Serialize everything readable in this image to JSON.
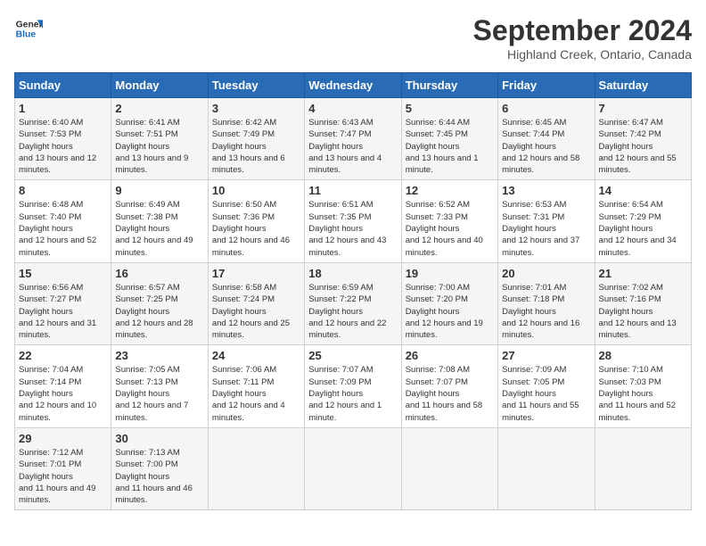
{
  "header": {
    "logo_line1": "General",
    "logo_line2": "Blue",
    "month": "September 2024",
    "location": "Highland Creek, Ontario, Canada"
  },
  "days_of_week": [
    "Sunday",
    "Monday",
    "Tuesday",
    "Wednesday",
    "Thursday",
    "Friday",
    "Saturday"
  ],
  "weeks": [
    [
      {
        "day": "1",
        "sunrise": "6:40 AM",
        "sunset": "7:53 PM",
        "daylight": "13 hours and 12 minutes."
      },
      {
        "day": "2",
        "sunrise": "6:41 AM",
        "sunset": "7:51 PM",
        "daylight": "13 hours and 9 minutes."
      },
      {
        "day": "3",
        "sunrise": "6:42 AM",
        "sunset": "7:49 PM",
        "daylight": "13 hours and 6 minutes."
      },
      {
        "day": "4",
        "sunrise": "6:43 AM",
        "sunset": "7:47 PM",
        "daylight": "13 hours and 4 minutes."
      },
      {
        "day": "5",
        "sunrise": "6:44 AM",
        "sunset": "7:45 PM",
        "daylight": "13 hours and 1 minute."
      },
      {
        "day": "6",
        "sunrise": "6:45 AM",
        "sunset": "7:44 PM",
        "daylight": "12 hours and 58 minutes."
      },
      {
        "day": "7",
        "sunrise": "6:47 AM",
        "sunset": "7:42 PM",
        "daylight": "12 hours and 55 minutes."
      }
    ],
    [
      {
        "day": "8",
        "sunrise": "6:48 AM",
        "sunset": "7:40 PM",
        "daylight": "12 hours and 52 minutes."
      },
      {
        "day": "9",
        "sunrise": "6:49 AM",
        "sunset": "7:38 PM",
        "daylight": "12 hours and 49 minutes."
      },
      {
        "day": "10",
        "sunrise": "6:50 AM",
        "sunset": "7:36 PM",
        "daylight": "12 hours and 46 minutes."
      },
      {
        "day": "11",
        "sunrise": "6:51 AM",
        "sunset": "7:35 PM",
        "daylight": "12 hours and 43 minutes."
      },
      {
        "day": "12",
        "sunrise": "6:52 AM",
        "sunset": "7:33 PM",
        "daylight": "12 hours and 40 minutes."
      },
      {
        "day": "13",
        "sunrise": "6:53 AM",
        "sunset": "7:31 PM",
        "daylight": "12 hours and 37 minutes."
      },
      {
        "day": "14",
        "sunrise": "6:54 AM",
        "sunset": "7:29 PM",
        "daylight": "12 hours and 34 minutes."
      }
    ],
    [
      {
        "day": "15",
        "sunrise": "6:56 AM",
        "sunset": "7:27 PM",
        "daylight": "12 hours and 31 minutes."
      },
      {
        "day": "16",
        "sunrise": "6:57 AM",
        "sunset": "7:25 PM",
        "daylight": "12 hours and 28 minutes."
      },
      {
        "day": "17",
        "sunrise": "6:58 AM",
        "sunset": "7:24 PM",
        "daylight": "12 hours and 25 minutes."
      },
      {
        "day": "18",
        "sunrise": "6:59 AM",
        "sunset": "7:22 PM",
        "daylight": "12 hours and 22 minutes."
      },
      {
        "day": "19",
        "sunrise": "7:00 AM",
        "sunset": "7:20 PM",
        "daylight": "12 hours and 19 minutes."
      },
      {
        "day": "20",
        "sunrise": "7:01 AM",
        "sunset": "7:18 PM",
        "daylight": "12 hours and 16 minutes."
      },
      {
        "day": "21",
        "sunrise": "7:02 AM",
        "sunset": "7:16 PM",
        "daylight": "12 hours and 13 minutes."
      }
    ],
    [
      {
        "day": "22",
        "sunrise": "7:04 AM",
        "sunset": "7:14 PM",
        "daylight": "12 hours and 10 minutes."
      },
      {
        "day": "23",
        "sunrise": "7:05 AM",
        "sunset": "7:13 PM",
        "daylight": "12 hours and 7 minutes."
      },
      {
        "day": "24",
        "sunrise": "7:06 AM",
        "sunset": "7:11 PM",
        "daylight": "12 hours and 4 minutes."
      },
      {
        "day": "25",
        "sunrise": "7:07 AM",
        "sunset": "7:09 PM",
        "daylight": "12 hours and 1 minute."
      },
      {
        "day": "26",
        "sunrise": "7:08 AM",
        "sunset": "7:07 PM",
        "daylight": "11 hours and 58 minutes."
      },
      {
        "day": "27",
        "sunrise": "7:09 AM",
        "sunset": "7:05 PM",
        "daylight": "11 hours and 55 minutes."
      },
      {
        "day": "28",
        "sunrise": "7:10 AM",
        "sunset": "7:03 PM",
        "daylight": "11 hours and 52 minutes."
      }
    ],
    [
      {
        "day": "29",
        "sunrise": "7:12 AM",
        "sunset": "7:01 PM",
        "daylight": "11 hours and 49 minutes."
      },
      {
        "day": "30",
        "sunrise": "7:13 AM",
        "sunset": "7:00 PM",
        "daylight": "11 hours and 46 minutes."
      },
      null,
      null,
      null,
      null,
      null
    ]
  ]
}
